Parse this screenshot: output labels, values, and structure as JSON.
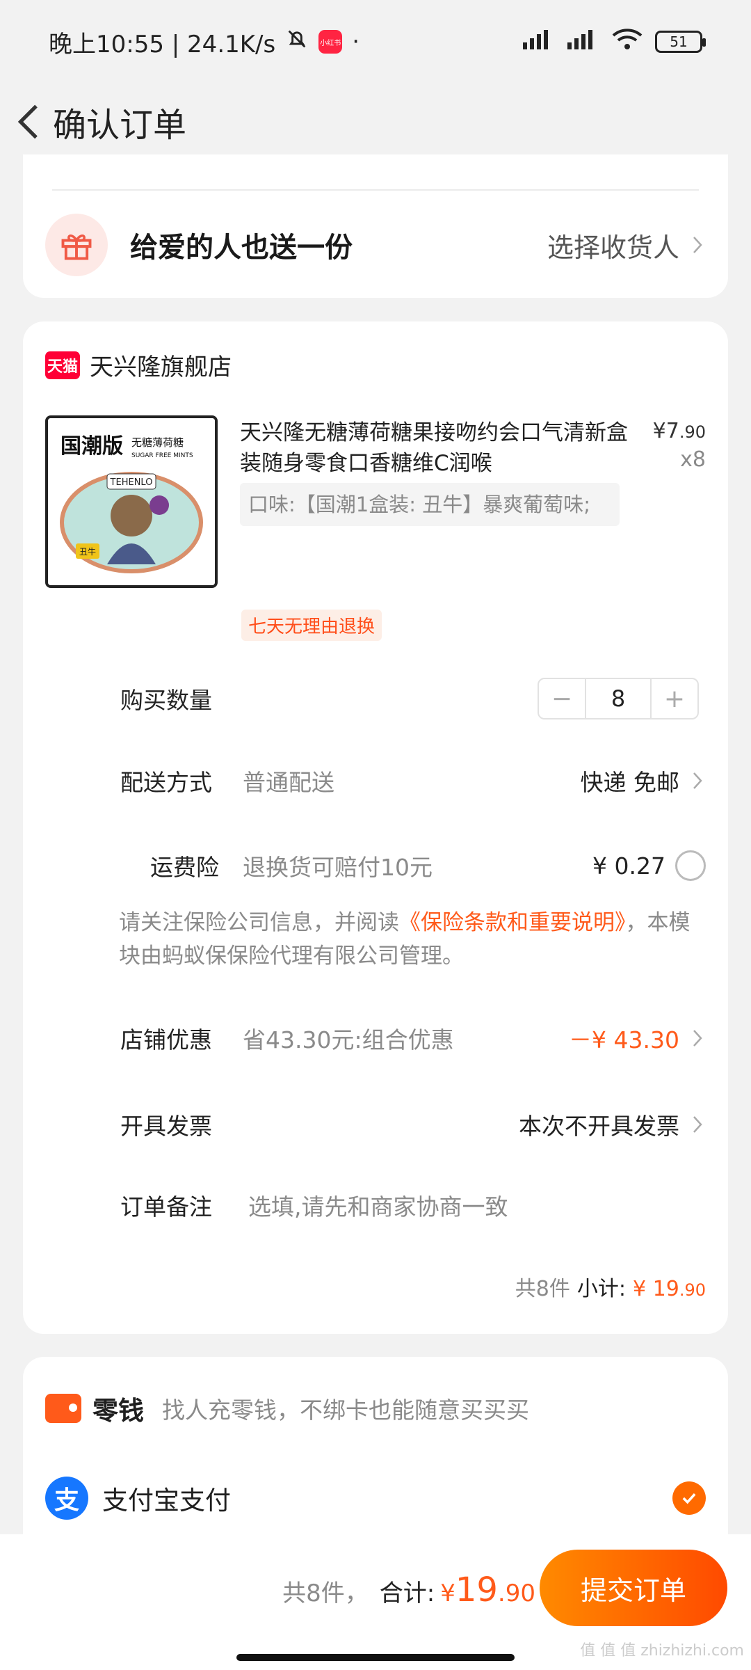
{
  "status_bar": {
    "time": "晚上10:55 | 24.1K/s",
    "app_badge": "小红书",
    "dot": "·",
    "battery": "51"
  },
  "nav": {
    "title": "确认订单"
  },
  "gift": {
    "title": "给爱的人也送一份",
    "action": "选择收货人"
  },
  "store": {
    "badge": "天猫",
    "name": "天兴隆旗舰店"
  },
  "product": {
    "title": "天兴隆无糖薄荷糖果接吻约会口气清新盒装随身零食口香糖维C润喉",
    "spec": "口味:【国潮1盒装: 丑牛】暴爽葡萄味;",
    "price_yen": "¥",
    "price_int": "7",
    "price_dec": ".90",
    "quantity_text": "x8",
    "return_tag": "七天无理由退换",
    "image_text": {
      "edition": "国潮版",
      "subtitle": "无糖薄荷糖",
      "subtitle_en": "SUGAR FREE MINTS",
      "brand": "TEHENLO",
      "zodiac": "丑牛"
    }
  },
  "quantity": {
    "label": "购买数量",
    "minus": "−",
    "value": "8",
    "plus": "+"
  },
  "delivery": {
    "label": "配送方式",
    "sub": "普通配送",
    "value": "快递 免邮"
  },
  "insurance": {
    "label": "运费险",
    "sub": "退换货可赔付10元",
    "value": "¥ 0.27"
  },
  "notice": {
    "prefix": "请关注保险公司信息，并阅读",
    "link": "《保险条款和重要说明》",
    "suffix": "，本模块由蚂蚁保保险代理有限公司管理。"
  },
  "discount": {
    "label": "店铺优惠",
    "sub": "省43.30元:组合优惠",
    "value": "－¥ 43.30"
  },
  "invoice": {
    "label": "开具发票",
    "value": "本次不开具发票"
  },
  "remark": {
    "label": "订单备注",
    "placeholder": "选填,请先和商家协商一致"
  },
  "subtotal": {
    "count": "共8件",
    "label": "小计:",
    "yen": "¥",
    "int": "19",
    "dec": ".90"
  },
  "payment": {
    "wallet_title": "零钱",
    "wallet_sub": "找人充零钱，不绑卡也能随意买买买",
    "alipay_icon": "支",
    "alipay_label": "支付宝支付"
  },
  "bottom": {
    "count": "共8件，",
    "label": "合计:",
    "yen": "¥",
    "int": "19",
    "dec": ".90",
    "submit": "提交订单",
    "watermark": "值 值 值 zhizhizhi.com"
  },
  "colors": {
    "accent": "#ff5a1a",
    "tmall": "#ff0036",
    "alipay": "#1677ff"
  }
}
